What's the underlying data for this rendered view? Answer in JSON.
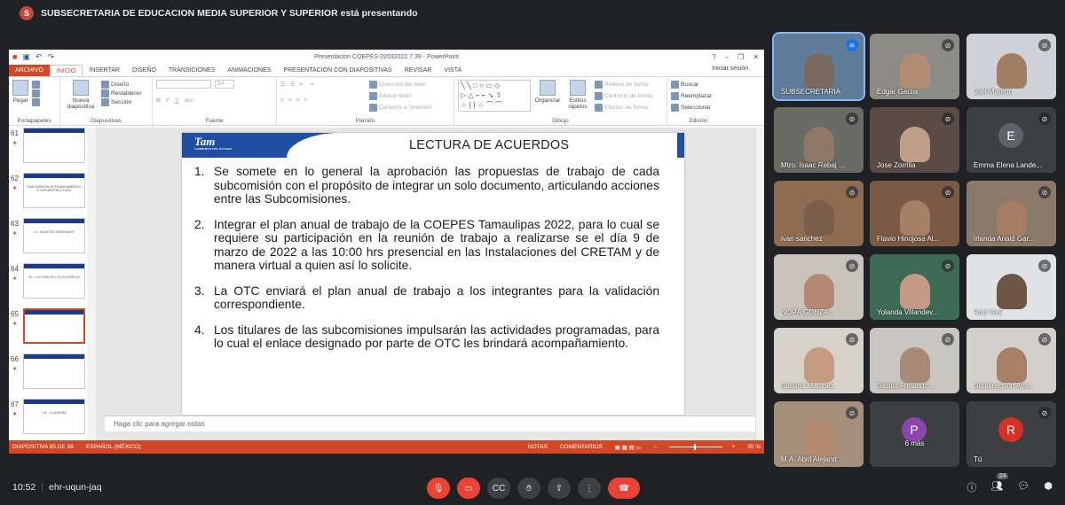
{
  "presenter": {
    "avatar": "S",
    "text": "SUBSECRETARIA DE EDUCACION MEDIA SUPERIOR Y SUPERIOR está presentando"
  },
  "ppt": {
    "window_title": "Presentacion COEPES 02032022 7.39 - PowerPoint",
    "tabs": [
      "ARCHIVO",
      "INICIO",
      "INSERTAR",
      "DISEÑO",
      "TRANSICIONES",
      "ANIMACIONES",
      "PRESENTACIÓN CON DIAPOSITIVAS",
      "REVISAR",
      "VISTA"
    ],
    "signin": "Iniciar sesión",
    "ribbon": {
      "paste": "Pegar",
      "clipboard": "Portapapeles",
      "new_slide_1": "Nueva",
      "new_slide_2": "diapositiva",
      "layout": "Diseño",
      "reset": "Restablecer",
      "section": "Sección",
      "slides": "Diapositivas",
      "font_size": "54",
      "font": "Fuente",
      "text_direction": "Dirección del texto",
      "align_text": "Alinear texto",
      "smartart": "Convertir a SmartArt",
      "paragraph": "Párrafo",
      "arrange": "Organizar",
      "quick_styles_1": "Estilos",
      "quick_styles_2": "rápidos",
      "shape_fill": "Relleno de forma",
      "shape_outline": "Contorno de forma",
      "shape_effects": "Efectos de forma",
      "drawing": "Dibujo",
      "find": "Buscar",
      "replace": "Reemplazar",
      "select": "Seleccionar",
      "editing": "Edición"
    },
    "thumbnails": [
      {
        "num": "61",
        "text": ""
      },
      {
        "num": "62",
        "text": "SUBCOMISION DE FINANCIAMIENTO E INFRAESTRUCTURA"
      },
      {
        "num": "63",
        "text": "VI.- ASUNTOS GENERALES"
      },
      {
        "num": "64",
        "text": "VII.- LECTURA DE LOS ACUERDOS"
      },
      {
        "num": "65",
        "text": ""
      },
      {
        "num": "66",
        "text": ""
      },
      {
        "num": "67",
        "text": "VIII.- CLAUSURA"
      }
    ],
    "slide": {
      "logo": "Tam",
      "logo_sub": "GOBIERNO DEL ESTADO",
      "title": "LECTURA DE ACUERDOS",
      "items": [
        {
          "n": "1.",
          "text": "Se somete en lo general la aprobación las propuestas de trabajo de cada subcomisión con el propósito de integrar un solo documento, articulando acciones entre las Subcomisiones."
        },
        {
          "n": "2.",
          "text": "Integrar el plan anual de trabajo de la COEPES Tamaulipas 2022, para lo cual se requiere su participación en la reunión de trabajo a realizarse se el día 9 de marzo de 2022 a las 10:00 hrs presencial en las Instalaciones del CRETAM y de manera virtual a quien así lo solicite."
        },
        {
          "n": "3.",
          "text": "La OTC enviará el plan anual de trabajo a los integrantes para la validación correspondiente."
        },
        {
          "n": "4.",
          "text": "Los titulares de las subcomisiones impulsarán las actividades programadas, para lo cual el enlace designado por parte de OTC les brindará acompañamiento."
        }
      ]
    },
    "notes_placeholder": "Haga clic para agregar notas",
    "status": {
      "slide_count": "DIAPOSITIVA 65 DE 68",
      "language": "ESPAÑOL (MÉXICO)",
      "notes": "NOTAS",
      "comments": "COMENTARIOS",
      "zoom": "35 %"
    }
  },
  "participants": [
    {
      "name": "SUBSECRETARIA",
      "mic": "active",
      "bg": "#5f7c99",
      "skin": "#7a6a5e"
    },
    {
      "name": "Edgar Garza",
      "mic": "muted",
      "bg": "#8d8b86",
      "skin": "#b28d74"
    },
    {
      "name": "Joel Moreno",
      "mic": "muted",
      "bg": "#cfd2d6",
      "skin": "#a17d64"
    },
    {
      "name": "Mtro. Isaac Rebaj ...",
      "mic": "muted",
      "bg": "#6a6b63",
      "skin": "#8e7766"
    },
    {
      "name": "Jose Zorrilla",
      "mic": "muted",
      "bg": "#5a4b45",
      "skin": "#c09f8a"
    },
    {
      "name": "Emma Elena Lande...",
      "mic": "muted",
      "avatar": "E",
      "avatar_color": "#5f6368"
    },
    {
      "name": "ivan sanchez",
      "mic": "muted",
      "bg": "#8e6c52",
      "skin": "#7a5d4b"
    },
    {
      "name": "Flavio Hinojosa Al...",
      "mic": "muted",
      "bg": "#7b5a45",
      "skin": "#a58066"
    },
    {
      "name": "Irlanda Anaid Gar...",
      "mic": "muted",
      "bg": "#8a7869",
      "skin": "#a77c64"
    },
    {
      "name": "NORA GONZA...",
      "mic": "muted",
      "bg": "#c8c3bb",
      "skin": "#b48872"
    },
    {
      "name": "Yolanda Villandev...",
      "mic": "muted",
      "bg": "#3c6a55",
      "skin": "#c49a86"
    },
    {
      "name": "Rod Vera",
      "mic": "muted",
      "bg": "#dfe3e6",
      "skin": "#6f5544"
    },
    {
      "name": "Susana Martinez",
      "mic": "muted",
      "bg": "#d7d2ca",
      "skin": "#c59c80"
    },
    {
      "name": "Basilio Armando ...",
      "mic": "muted",
      "bg": "#c9c5c0",
      "skin": "#a98a78"
    },
    {
      "name": "Subdirección Aca...",
      "mic": "muted",
      "bg": "#d3cfcb",
      "skin": "#a88065"
    },
    {
      "name": "M.A. Abril Alejand...",
      "mic": "muted",
      "bg": "#a58f7b",
      "skin": "#b38a6e"
    },
    {
      "name": "6 más",
      "mic": "none",
      "avatar": "P",
      "avatar_color": "#8e44ad"
    },
    {
      "name": "Tú",
      "mic": "muted",
      "avatar": "R",
      "avatar_color": "#d93025"
    }
  ],
  "meeting": {
    "time": "10:52",
    "code": "ehr-uqun-jaq",
    "people_count": "24"
  }
}
